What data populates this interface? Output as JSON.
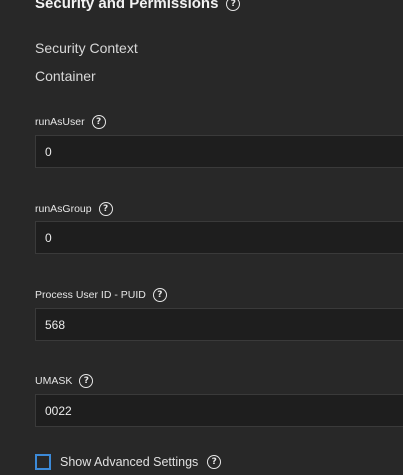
{
  "section": {
    "title": "Security and Permissions",
    "help_glyph": "?"
  },
  "subheadings": {
    "security_context": "Security Context",
    "container": "Container"
  },
  "fields": [
    {
      "label": "runAsUser",
      "value": "0"
    },
    {
      "label": "runAsGroup",
      "value": "0"
    },
    {
      "label": "Process User ID - PUID",
      "value": "568"
    },
    {
      "label": "UMASK",
      "value": "0022"
    }
  ],
  "advanced": {
    "label": "Show Advanced Settings",
    "checked": false
  },
  "colors": {
    "background": "#282828",
    "input_background": "#1e1e1e",
    "checkbox_accent": "#3c8ad8"
  },
  "icons": {
    "help": "help-circle-icon"
  }
}
